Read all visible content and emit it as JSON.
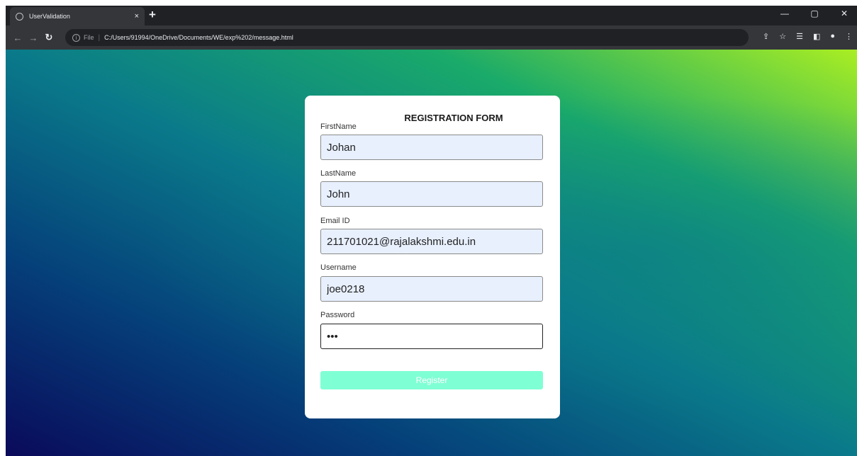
{
  "browser": {
    "tab_title": "UserValidation",
    "tab_close": "×",
    "new_tab": "+",
    "scheme": "File",
    "url": "C:/Users/91994/OneDrive/Documents/WE/exp%202/message.html",
    "controls": {
      "minimize": "—",
      "restore": "▢",
      "close": "✕"
    }
  },
  "form": {
    "title": "REGISTRATION FORM",
    "fields": [
      {
        "label": "FirstName",
        "value": "Johan"
      },
      {
        "label": "LastName",
        "value": "John"
      },
      {
        "label": "Email ID",
        "value": "211701021@rajalakshmi.edu.in"
      },
      {
        "label": "Username",
        "value": "joe0218"
      },
      {
        "label": "Password",
        "value": "•••"
      }
    ],
    "submit_label": "Register"
  },
  "colors": {
    "input_autofill_bg": "#e8f0fe",
    "register_button_bg": "#7fffd4"
  }
}
